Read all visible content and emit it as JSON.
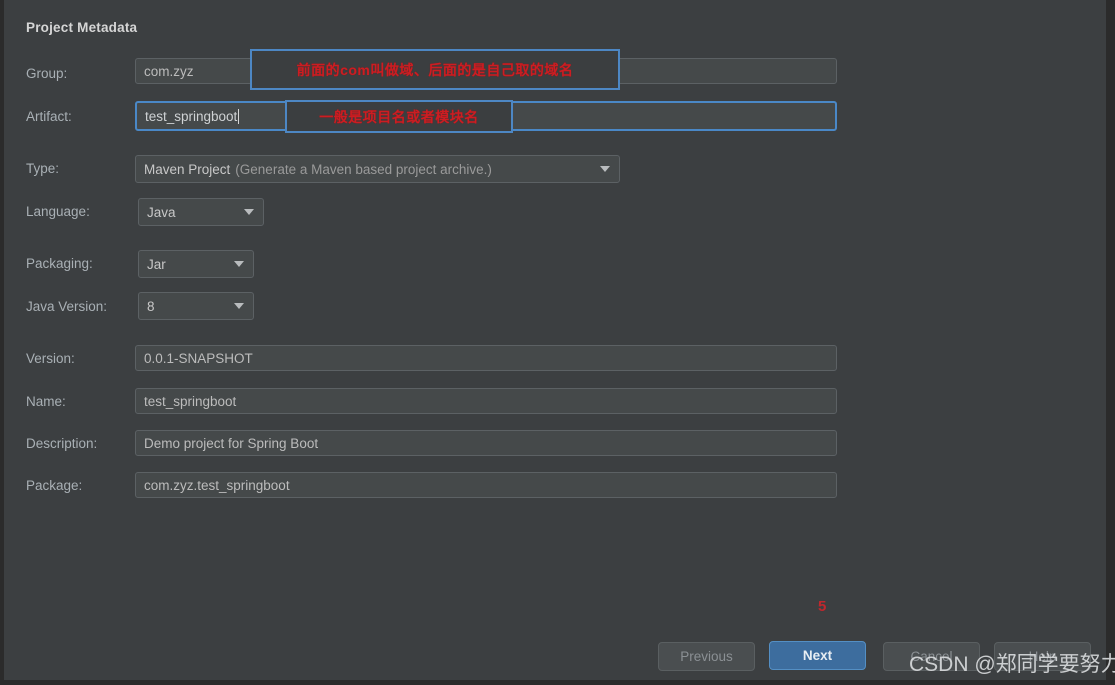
{
  "dialog": {
    "section_title": "Project Metadata"
  },
  "form": {
    "group": {
      "label": "Group:",
      "value": "com.zyz"
    },
    "artifact": {
      "label": "Artifact:",
      "value": "test_springboot",
      "focused": true
    },
    "type": {
      "label": "Type:",
      "value": "Maven Project",
      "hint": "(Generate a Maven based project archive.)",
      "arrow_icon": "chevron-down-icon"
    },
    "language": {
      "label": "Language:",
      "value": "Java",
      "arrow_icon": "chevron-down-icon"
    },
    "packaging": {
      "label": "Packaging:",
      "value": "Jar",
      "arrow_icon": "chevron-down-icon"
    },
    "java_version": {
      "label": "Java Version:",
      "value": "8",
      "arrow_icon": "chevron-down-icon"
    },
    "version": {
      "label": "Version:",
      "value": "0.0.1-SNAPSHOT"
    },
    "name": {
      "label": "Name:",
      "value": "test_springboot"
    },
    "description": {
      "label": "Description:",
      "value": "Demo project for Spring Boot"
    },
    "package": {
      "label": "Package:",
      "value": "com.zyz.test_springboot"
    }
  },
  "annotations": {
    "group_note": "前面的com叫做域、后面的是自己取的域名",
    "artifact_note": "一般是项目名或者模块名",
    "step_marker": "5"
  },
  "buttons": {
    "previous": "Previous",
    "next": "Next",
    "cancel": "Cancel",
    "help": "Help"
  },
  "watermark": {
    "text": "CSDN @郑同学要努力"
  },
  "colors": {
    "background": "#3c3f41",
    "field_border": "#5c6164",
    "focus_blue": "#4a88c7",
    "primary_button": "#3d6d9e",
    "annotation_red": "#cc1d22"
  }
}
